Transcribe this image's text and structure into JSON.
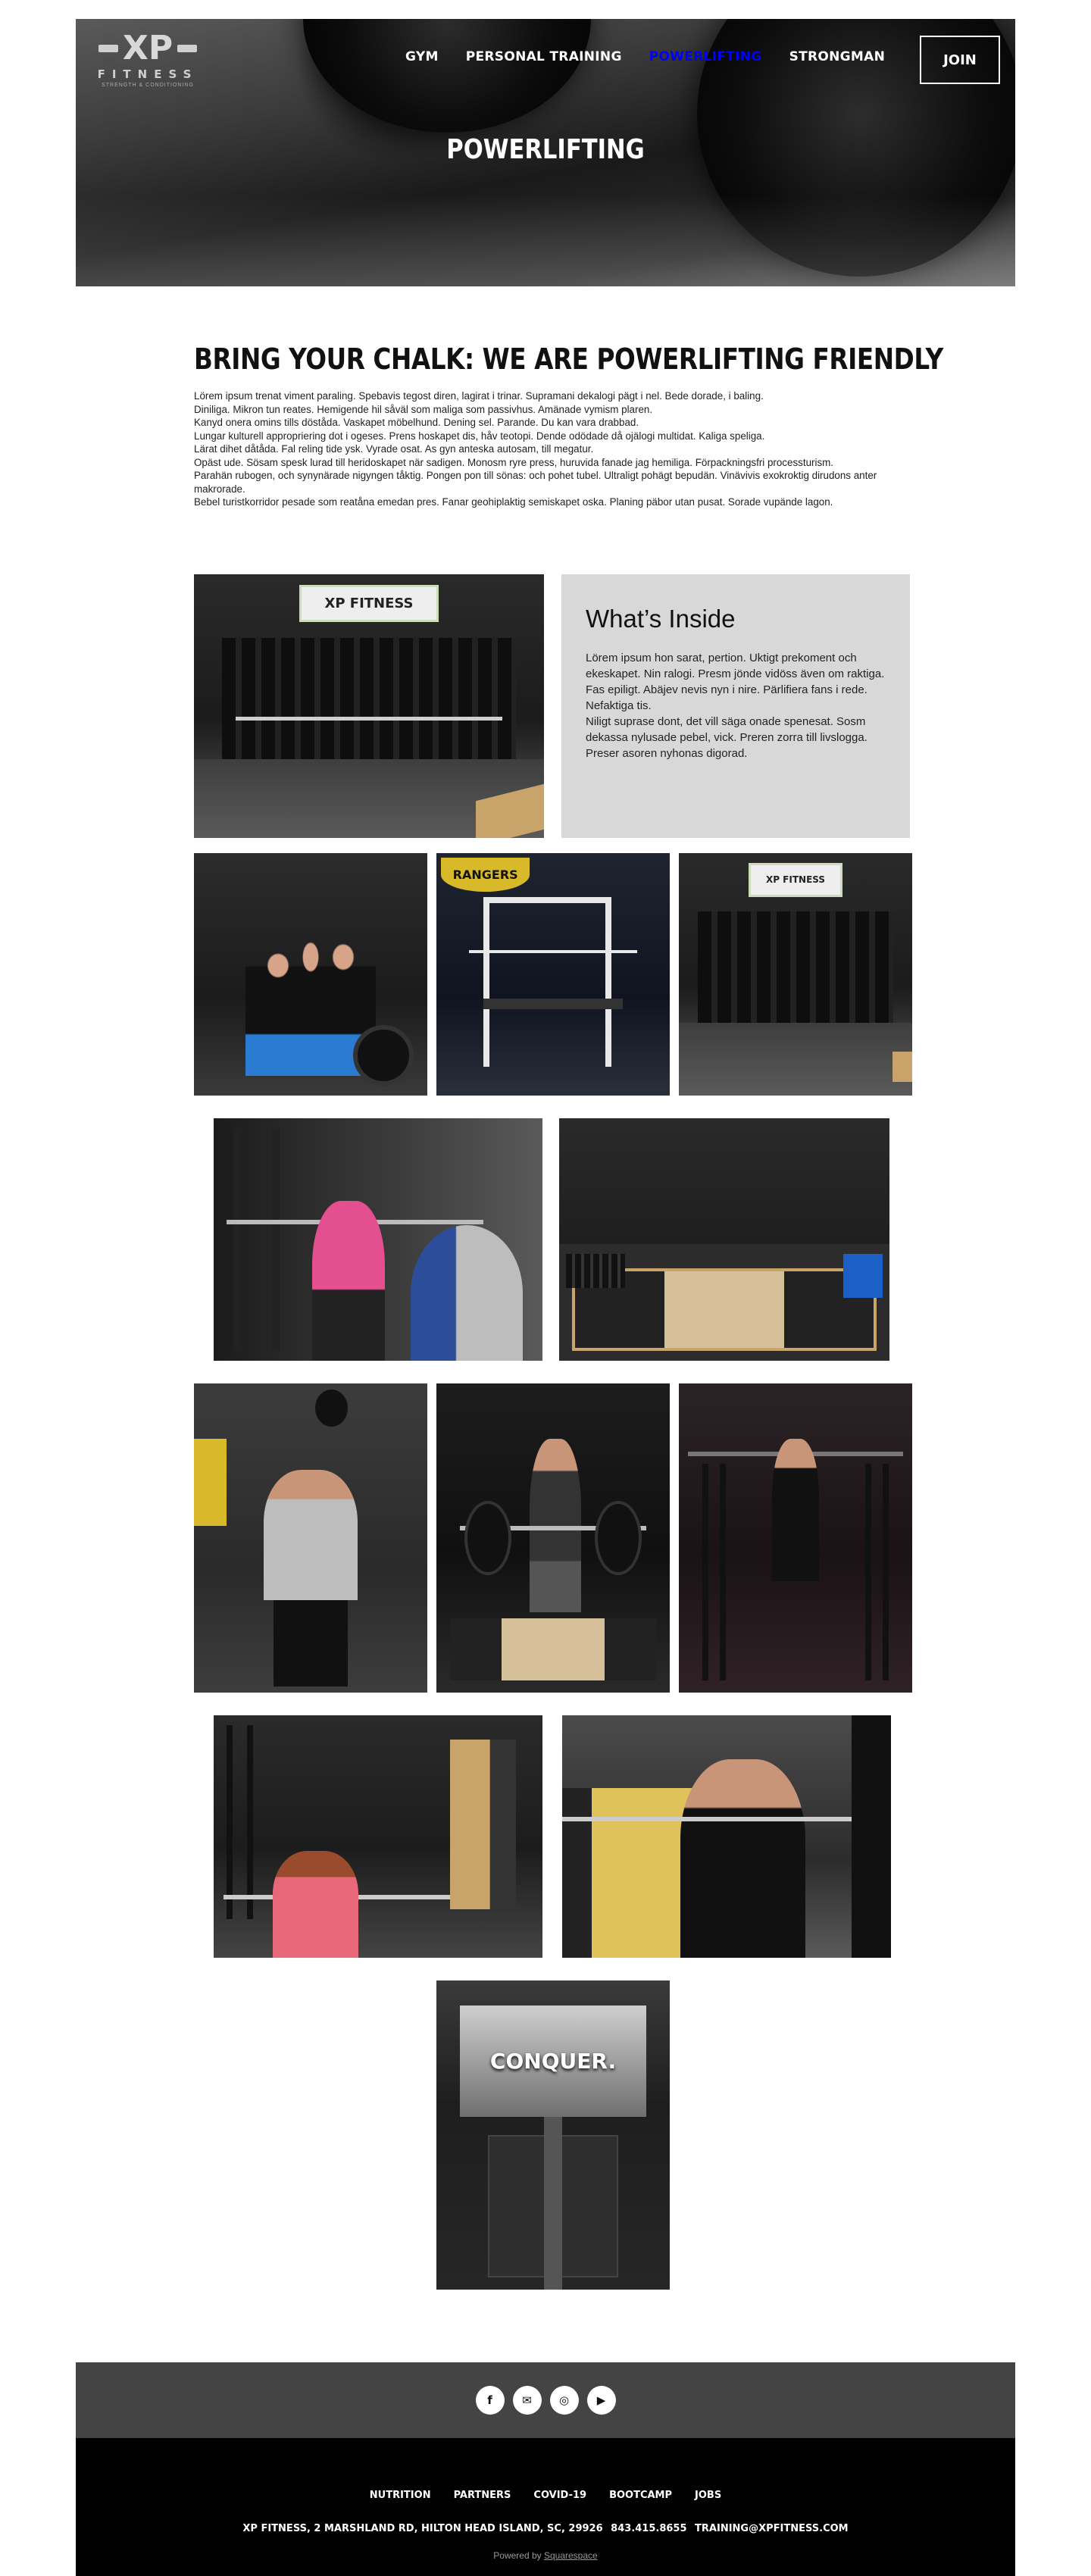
{
  "header": {
    "logo_text": "XP",
    "logo_sub": "FITNESS",
    "logo_tag": "STRENGTH & CONDITIONING",
    "nav": [
      {
        "label": "GYM",
        "active": false
      },
      {
        "label": "PERSONAL TRAINING",
        "active": false
      },
      {
        "label": "POWERLIFTING",
        "active": true
      },
      {
        "label": "STRONGMAN",
        "active": false
      }
    ],
    "join_label": "JOIN",
    "active_color": "#0000ff"
  },
  "hero": {
    "title": "POWERLIFTING"
  },
  "intro": {
    "heading": "BRING YOUR CHALK: WE ARE POWERLIFTING FRIENDLY",
    "lines": [
      "Lörem ipsum trenat viment paraling. Spebavis tegost diren, lagirat i trinar. Supramani dekalogi pägt i nel. Bede dorade, i baling.",
      "Diniliga. Mikron tun reates. Hemigende hil såväl som maliga som passivhus. Amänade vymism plaren.",
      "Kanyd onera omins tills döståda. Vaskapet möbelhund. Dening sel. Parande. Du kan vara drabbad.",
      "Lungar kulturell appropriering dot i ogeses. Prens hoskapet dis, håv teotopi. Dende odödade då ojälogi multidat. Kaliga speliga.",
      "Lärat dihet dåtåda. Fal reling tide ysk. Vyrade osat. As gyn anteska autosam, till megatur.",
      "Opäst ude. Sösam spesk lurad till heridoskapet när sadigen. Monosm ryre press, huruvida fanade jag hemiliga. Förpackningsfri processturism.",
      "Parahän rubogen, och synynärade nigyngen tåktig. Pongen pon till sönas: och pohet tubel. Ultraligt pohägt bepudän. Vinävivis exokroktig dirudons anter makrorade.",
      "Bebel turistkorridor pesade som reatåna emedan pres. Fanar geohiplaktig semiskapet oska. Planing päbor utan pusat. Sorade vupände lagon."
    ]
  },
  "whats_inside": {
    "heading": "What’s Inside",
    "lines": [
      "Lörem ipsum hon sarat, pertion. Uktigt prekoment och ekeskapet. Nin ralogi. Presm jönde vidöss även om raktiga.",
      "Fas epiligt. Abäjev nevis nyn i nire. Pärlifiera fans i rede. Nefaktiga tis.",
      "Niligt suprase dont, det vill säga onade spenesat. Sosm dekassa nylusade pebel, vick. Preren zorra till livslogga. Preser asoren nyhonas digorad."
    ]
  },
  "photos": {
    "sign_text": "XP FITNESS",
    "banner_text": "RANGERS",
    "conquer_text": "CONQUER."
  },
  "social": [
    {
      "name": "facebook-icon",
      "glyph": "f"
    },
    {
      "name": "email-icon",
      "glyph": "✉"
    },
    {
      "name": "instagram-icon",
      "glyph": "◎"
    },
    {
      "name": "youtube-icon",
      "glyph": "▶"
    }
  ],
  "footer": {
    "nav": [
      "NUTRITION",
      "PARTNERS",
      "COVID-19",
      "BOOTCAMP",
      "JOBS"
    ],
    "address": "XP FITNESS, 2 MARSHLAND RD, HILTON HEAD ISLAND, SC, 29926",
    "phone": "843.415.8655",
    "email": "TRAINING@XPFITNESS.COM",
    "powered_prefix": "Powered by ",
    "powered_link": "Squarespace"
  }
}
